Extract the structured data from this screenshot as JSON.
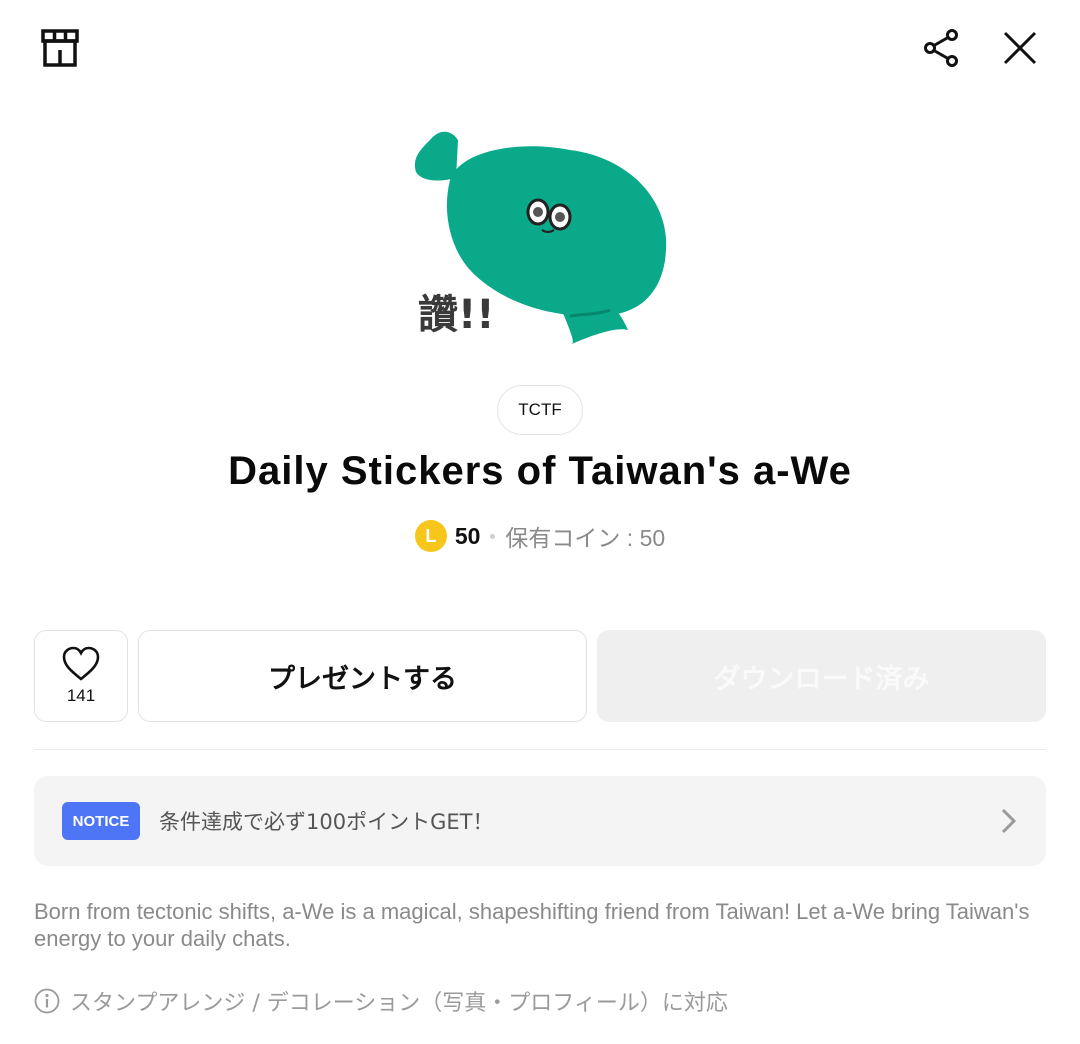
{
  "header": {
    "shop_icon": "shop-icon",
    "share_icon": "share-icon",
    "close_icon": "close-icon"
  },
  "sticker": {
    "caption": "讚!!"
  },
  "product": {
    "author": "TCTF",
    "title": "Daily Stickers of Taiwan's a-We",
    "coin_symbol": "L",
    "price": "50",
    "owned_coins": "保有コイン : 50"
  },
  "actions": {
    "like_count": "141",
    "gift_label": "プレゼントする",
    "download_label": "ダウンロード済み"
  },
  "notice": {
    "badge": "NOTICE",
    "text": "条件達成で必ず100ポイントGET！"
  },
  "description": "Born from tectonic shifts, a-We is a magical, shapeshifting friend from Taiwan! Let a-We bring Taiwan's energy to your daily chats.",
  "compatibility": "スタンプアレンジ / デコレーション（写真・プロフィール）に対応",
  "colors": {
    "accent": "#4d75f5",
    "coin": "#f7c61a",
    "sticker_green": "#0aa98a"
  }
}
